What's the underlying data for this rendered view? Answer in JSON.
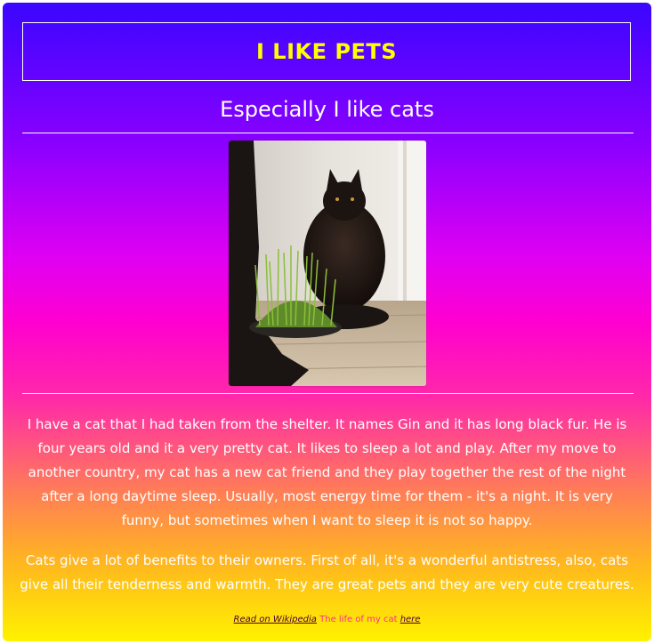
{
  "header": {
    "title": "I LIKE PETS",
    "subtitle": "Especially I like cats"
  },
  "image": {
    "alt": "black cat sitting next to a pot of cat grass"
  },
  "content": {
    "paragraph1": "I have a cat that I had taken from the shelter. It names Gin and it has long black fur. He is four years old and it a very pretty cat. It likes to sleep a lot and play. After my move to another country, my cat has a new cat friend and they play together the rest of the night after a long daytime sleep. Usually, most energy time for them - it's a night. It is very funny, but sometimes when I want to sleep it is not so happy.",
    "paragraph2": "Cats give a lot of benefits to their owners. First of all, it's a wonderful antistress, also, cats give all their tenderness and warmth. They are great pets and they are very cute creatures."
  },
  "footer": {
    "link1": "Read on Wikipedia",
    "middle": " The life of my cat ",
    "link2": "here"
  },
  "colors": {
    "title": "#ffff00",
    "gradient_top": "#3a06ff",
    "gradient_mid": "#ff00d0",
    "gradient_bottom": "#fff200"
  }
}
